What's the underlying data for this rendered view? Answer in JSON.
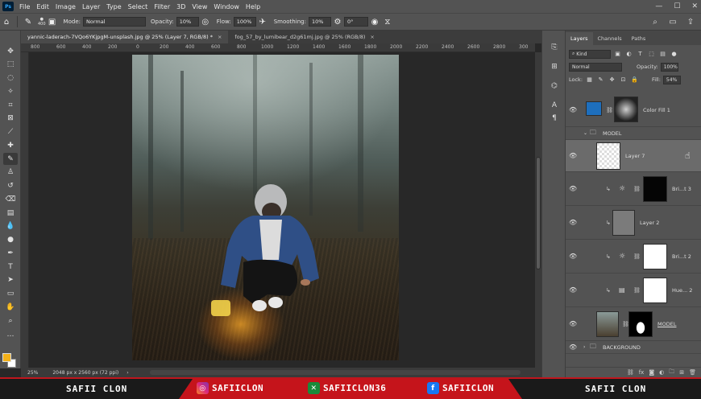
{
  "menu": {
    "items": [
      "File",
      "Edit",
      "Image",
      "Layer",
      "Type",
      "Select",
      "Filter",
      "3D",
      "View",
      "Window",
      "Help"
    ]
  },
  "options": {
    "brush_size": "400",
    "mode_label": "Mode:",
    "mode_value": "Normal",
    "opacity_label": "Opacity:",
    "opacity_value": "10%",
    "flow_label": "Flow:",
    "flow_value": "100%",
    "smoothing_label": "Smoothing:",
    "smoothing_value": "10%",
    "angle_value": "0°"
  },
  "tabs": [
    {
      "label": "yannic-laderach-7VQo6YKjpgM-unsplash.jpg @ 25% (Layer 7, RGB/8) *",
      "close": "×"
    },
    {
      "label": "fog_57_by_lumibear_d2g61mj.jpg @ 25% (RGB/8)",
      "close": "×"
    }
  ],
  "ruler": {
    "top": [
      "800",
      "600",
      "400",
      "200",
      "0",
      "200",
      "400",
      "600",
      "800",
      "1000",
      "1200",
      "1400",
      "1600",
      "1800",
      "2000",
      "2200",
      "2400",
      "2600",
      "2800",
      "300"
    ]
  },
  "status": {
    "zoom": "25%",
    "doc_size": "2048 px x 2560 px (72 ppi)",
    "arrow": "›"
  },
  "layers_panel": {
    "tabs": [
      "Layers",
      "Channels",
      "Paths"
    ],
    "filter_kind": "Kind",
    "blend_mode": "Normal",
    "opacity_label": "Opacity:",
    "opacity_value": "100%",
    "lock_label": "Lock:",
    "fill_label": "Fill:",
    "fill_value": "54%",
    "layers": [
      {
        "name": "Color Fill 1"
      },
      {
        "name": "MODEL"
      },
      {
        "name": "Layer 7"
      },
      {
        "name": "Bri...t 3"
      },
      {
        "name": "Layer 2"
      },
      {
        "name": "Bri...t 2"
      },
      {
        "name": "Hue... 2"
      },
      {
        "name": "MODEL"
      },
      {
        "name": "BACKGROUND"
      }
    ]
  },
  "banner": {
    "left_brand": "SAFII CLON",
    "right_brand": "SAFII CLON",
    "instagram": "SAFIICLON",
    "twitter": "SAFIICLON36",
    "facebook": "SAFIICLON"
  },
  "colors": {
    "foreground_swatch": "#f2b018",
    "background_swatch": "#ffffff",
    "color_fill_thumb": "#1e6fbd",
    "banner_red": "#c5141b"
  }
}
